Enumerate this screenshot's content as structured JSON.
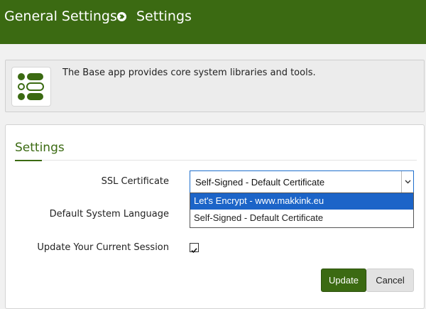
{
  "breadcrumb": {
    "section": "General Settings",
    "page": "Settings"
  },
  "info": {
    "text": "The Base app provides core system libraries and tools."
  },
  "panel": {
    "title": "Settings"
  },
  "form": {
    "ssl_label": "SSL Certificate",
    "ssl_value": "Self-Signed - Default Certificate",
    "ssl_options": [
      "Let's Encrypt - www.makkink.eu",
      "Self-Signed - Default Certificate"
    ],
    "highlighted_option": "Let's Encrypt - www.makkink.eu",
    "language_label": "Default System Language",
    "session_label": "Update Your Current Session",
    "session_checked": true
  },
  "buttons": {
    "update": "Update",
    "cancel": "Cancel"
  },
  "colors": {
    "header": "#3b6a12",
    "accent": "#3b6a12",
    "highlight": "#1c64c8"
  }
}
